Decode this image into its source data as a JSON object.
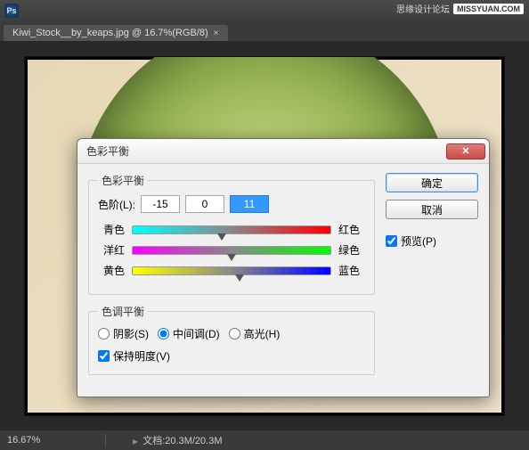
{
  "app": {
    "icon_text": "Ps",
    "watermark_text": "思缘设计论坛",
    "watermark_logo": "MISSYUAN.COM"
  },
  "tab": {
    "label": "Kiwi_Stock__by_keaps.jpg @ 16.7%(RGB/8)",
    "close": "×"
  },
  "status": {
    "zoom": "16.67%",
    "doc_label": "文档:",
    "doc_value": "20.3M/20.3M",
    "tri": "▶"
  },
  "dialog": {
    "title": "色彩平衡",
    "close_glyph": "✕",
    "group_balance": {
      "legend": "色彩平衡",
      "level_label": "色阶(L):",
      "values": [
        "-15",
        "0",
        "11"
      ],
      "sliders": [
        {
          "left": "青色",
          "right": "红色",
          "pos": 45
        },
        {
          "left": "洋红",
          "right": "绿色",
          "pos": 50
        },
        {
          "left": "黄色",
          "right": "蓝色",
          "pos": 54
        }
      ]
    },
    "group_tone": {
      "legend": "色调平衡",
      "options": {
        "shadows": "阴影(S)",
        "midtones": "中间调(D)",
        "highlights": "高光(H)"
      },
      "selected": "midtones",
      "preserve": "保持明度(V)"
    },
    "buttons": {
      "ok": "确定",
      "cancel": "取消"
    },
    "preview_label": "预览(P)"
  }
}
